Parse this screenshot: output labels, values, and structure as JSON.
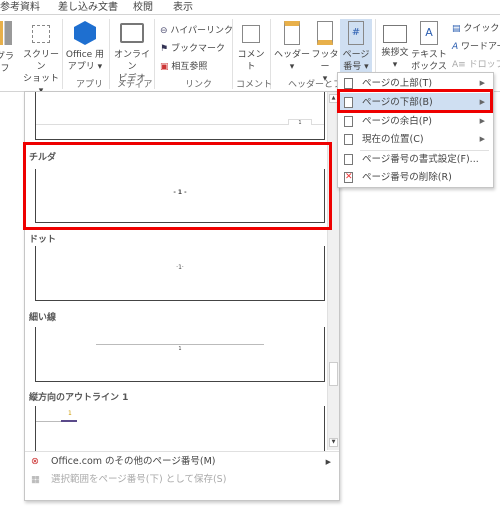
{
  "tabs": [
    "参考資料",
    "差し込み文書",
    "校閲",
    "表示"
  ],
  "ribbon": {
    "buttons": {
      "chart": "グラフ",
      "screenshot": [
        "スクリーン",
        "ショット ▾"
      ],
      "office_apps": [
        "Office 用",
        "アプリ ▾"
      ],
      "online_video": [
        "オンライン",
        "ビデオ"
      ],
      "comment": "コメント",
      "header": [
        "ヘッダー",
        "▾"
      ],
      "footer": [
        "フッター",
        "▾"
      ],
      "page_number": [
        "ページ",
        "番号 ▾"
      ],
      "greeting": [
        "挨拶文",
        "▾"
      ],
      "textbox": [
        "テキスト",
        "ボックス ▾"
      ]
    },
    "links": [
      "ハイパーリンク",
      "ブックマーク",
      "相互参照"
    ],
    "right_col": [
      "クイック パ",
      "ワードアー",
      "ドロップ キ"
    ],
    "groups": [
      "アプリ",
      "メディア",
      "リンク",
      "コメント",
      "ヘッダーとフッ"
    ]
  },
  "gallery": {
    "items": [
      {
        "label": "チルダ",
        "preview": "- 1 -"
      },
      {
        "label": "ドット",
        "preview": "·1·"
      },
      {
        "label": "細い線",
        "preview": "1"
      },
      {
        "label": "縦方向のアウトライン 1",
        "preview": "1"
      }
    ],
    "top_preview": "1",
    "footer": [
      "Office.com のその他のページ番号(M)",
      "選択範囲をページ番号(下) として保存(S)"
    ]
  },
  "menu": {
    "items": [
      "ページの上部(T)",
      "ページの下部(B)",
      "ページの余白(P)",
      "現在の位置(C)",
      "ページ番号の書式設定(F)...",
      "ページ番号の削除(R)"
    ]
  },
  "colors": {
    "highlight": "#cfdff2",
    "annotation": "#ee0000",
    "office_blue": "#1e6fd0"
  }
}
